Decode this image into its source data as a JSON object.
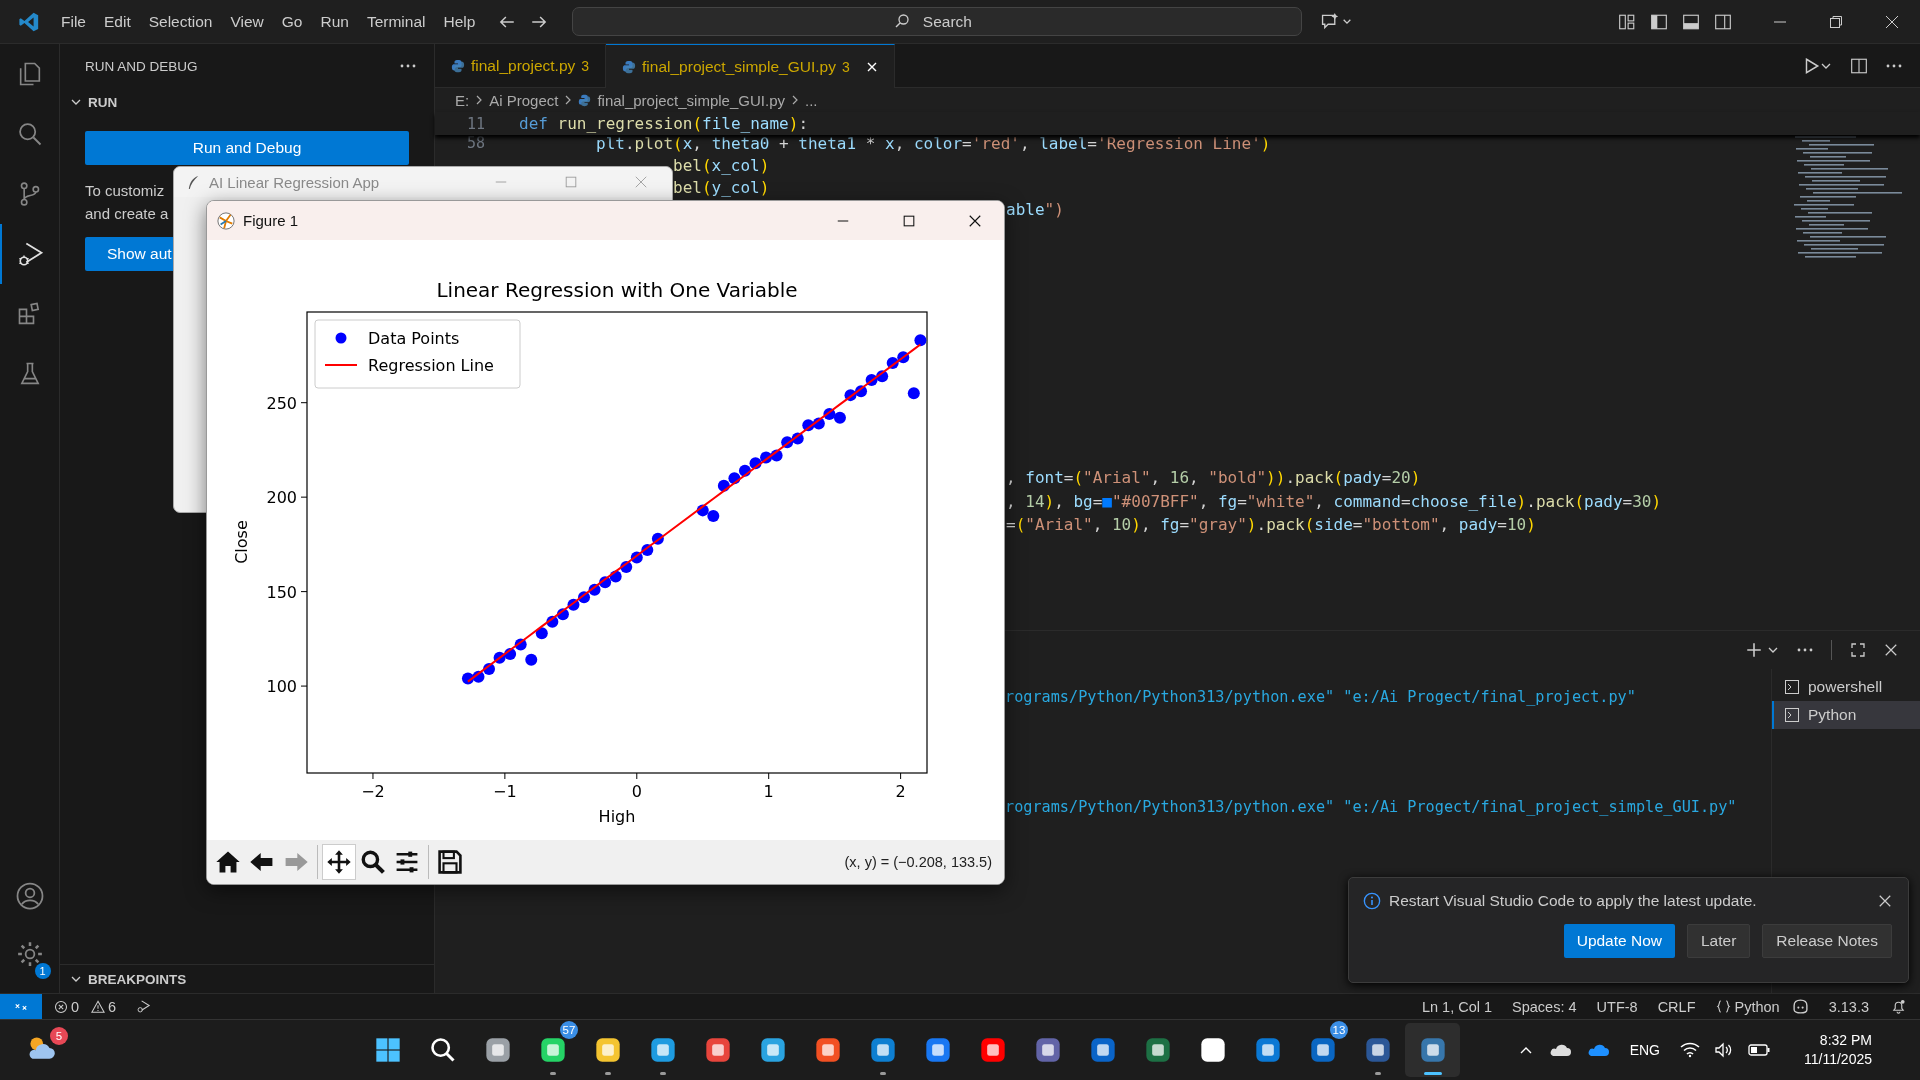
{
  "titlebar": {
    "menu": [
      "File",
      "Edit",
      "Selection",
      "View",
      "Go",
      "Run",
      "Terminal",
      "Help"
    ],
    "search": {
      "placeholder": "Search"
    }
  },
  "activity_bar": {
    "items": [
      {
        "kind": "explorer",
        "selected": false
      },
      {
        "kind": "search",
        "selected": false
      },
      {
        "kind": "source-control",
        "selected": false
      },
      {
        "kind": "run-debug",
        "selected": true
      },
      {
        "kind": "extensions",
        "selected": false
      },
      {
        "kind": "testing",
        "selected": false
      }
    ],
    "settings_badge": "1"
  },
  "sidebar": {
    "title": "RUN AND DEBUG",
    "section": {
      "title": "RUN",
      "expanded": true
    },
    "run_button": "Run and Debug",
    "hint_lines": [
      "To customiz",
      "and create a"
    ],
    "show_button": "Show aut",
    "breakpoints": {
      "title": "BREAKPOINTS",
      "expanded": true
    }
  },
  "editor": {
    "tabs": [
      {
        "name": "final_project.py",
        "problems": "3",
        "selected": false
      },
      {
        "name": "final_project_simple_GUI.py",
        "problems": "3",
        "selected": true
      }
    ],
    "breadcrumb": [
      "E:",
      "Ai Progect",
      "final_project_simple_GUI.py",
      "..."
    ],
    "sticky": {
      "number": "11",
      "code": "def run_regression(file_name):"
    },
    "upper_lines": [
      {
        "number": "58",
        "kind": "indented",
        "code": "plt.plot(x, theta0 + theta1 * x, color='red', label='Regression Line')"
      },
      {
        "kind": "after-tk",
        "code": "bel(x_col)"
      },
      {
        "kind": "after-tk",
        "code": "bel(y_col)"
      },
      {
        "kind": "after-figure",
        "code": "able\")"
      }
    ],
    "lower_lines": [
      {
        "kind": "after-figure",
        "code": ", font=(\"Arial\", 16, \"bold\")).pack(pady=20)"
      },
      {
        "kind": "after-figure",
        "code": ", 14), bg=■\"#007BFF\", fg=\"white\", command=choose_file).pack(pady=30)"
      },
      {
        "kind": "after-figure",
        "code": "=(\"Arial\", 10), fg=\"gray\").pack(side=\"bottom\", pady=10)"
      }
    ]
  },
  "terminal": {
    "lines": [
      "rograms/Python/Python313/python.exe\" \"e:/Ai Progect/final_project.py\"",
      "rograms/Python/Python313/python.exe\" \"e:/Ai Progect/final_project_simple_GUI.py\""
    ],
    "sessions": [
      {
        "name": "powershell",
        "selected": false
      },
      {
        "name": "Python",
        "selected": true
      }
    ]
  },
  "notification": {
    "message": "Restart Visual Studio Code to apply the latest update.",
    "buttons": [
      {
        "label": "Update Now",
        "kind": "primary"
      },
      {
        "label": "Later",
        "kind": "secondary"
      },
      {
        "label": "Release Notes",
        "kind": "secondary"
      }
    ]
  },
  "status_bar": {
    "errors": "0",
    "warnings": "6",
    "items": [
      {
        "kind": "text",
        "text": "Ln 1, Col 1"
      },
      {
        "kind": "text",
        "text": "Spaces: 4"
      },
      {
        "kind": "text",
        "text": "UTF-8"
      },
      {
        "kind": "text",
        "text": "CRLF"
      },
      {
        "kind": "language",
        "text": "Python"
      },
      {
        "kind": "version",
        "text": "3.13.3"
      }
    ]
  },
  "tk_window": {
    "title": "AI Linear Regression App"
  },
  "figure": {
    "title": "Figure 1",
    "coordinates": "(x, y) = (−0.208, 133.5)",
    "toolbar": [
      {
        "kind": "home"
      },
      {
        "kind": "back",
        "disabled": false
      },
      {
        "kind": "forward",
        "disabled": true
      },
      {
        "kind": "pan",
        "selected": true
      },
      {
        "kind": "zoom",
        "selected": false
      },
      {
        "kind": "configure"
      },
      {
        "kind": "save"
      }
    ],
    "chart_data": {
      "type": "scatter",
      "title": "Linear Regression with One Variable",
      "xlabel": "High",
      "ylabel": "Close",
      "x": [
        -1.28,
        -1.2,
        -1.12,
        -1.04,
        -0.96,
        -0.88,
        -0.8,
        -0.72,
        -0.64,
        -0.56,
        -0.48,
        -0.4,
        -0.32,
        -0.24,
        -0.16,
        -0.08,
        0.0,
        0.08,
        0.16,
        0.5,
        0.58,
        0.66,
        0.74,
        0.82,
        0.9,
        0.98,
        1.06,
        1.14,
        1.22,
        1.3,
        1.38,
        1.46,
        1.54,
        1.62,
        1.7,
        1.78,
        1.86,
        1.94,
        2.02,
        2.1,
        2.15
      ],
      "series": [
        {
          "name": "Data Points",
          "type": "scatter",
          "color": "#0000ff",
          "values": [
            104,
            105,
            109,
            115,
            117,
            122,
            114,
            128,
            134,
            138,
            143,
            147,
            151,
            155,
            158,
            163,
            168,
            172,
            178,
            193,
            190,
            206,
            210,
            214,
            218,
            221,
            222,
            229,
            231,
            238,
            239,
            244,
            242,
            254,
            256,
            262,
            264,
            271,
            274,
            255,
            283
          ]
        },
        {
          "name": "Regression Line",
          "type": "line",
          "color": "#ff0000",
          "values": [
            102.4,
            106.6,
            110.8,
            114.9,
            119.1,
            123.2,
            127.4,
            131.6,
            135.7,
            139.9,
            144.0,
            148.2,
            152.4,
            156.5,
            160.7,
            164.8,
            169.0,
            173.2,
            177.3,
            195.0,
            199.2,
            203.3,
            207.5,
            211.6,
            215.8,
            220.0,
            224.1,
            228.3,
            232.4,
            236.6,
            240.8,
            244.9,
            249.1,
            253.2,
            257.4,
            261.6,
            265.7,
            269.9,
            274.0,
            278.2,
            280.8
          ]
        }
      ],
      "legend": "upper left",
      "xlim": [
        -2.5,
        2.2
      ],
      "ylim": [
        54,
        298
      ],
      "xticks": [
        {
          "value": -2,
          "label": "−2"
        },
        {
          "value": -1,
          "label": "−1"
        },
        0,
        1,
        2
      ],
      "yticks": [
        100,
        150,
        200,
        250
      ]
    }
  },
  "taskbar": {
    "widgets_badge": "5",
    "apps": [
      {
        "running": false,
        "active": false
      },
      {
        "running": false,
        "active": false
      },
      {
        "running": false,
        "active": false
      },
      {
        "running": true,
        "active": false,
        "badge": "57"
      },
      {
        "running": true,
        "active": false
      },
      {
        "running": true,
        "active": false
      },
      {
        "running": false,
        "active": false
      },
      {
        "running": false,
        "active": false
      },
      {
        "running": false,
        "active": false
      },
      {
        "running": true,
        "active": false
      },
      {
        "running": false,
        "active": false
      },
      {
        "running": false,
        "active": false
      },
      {
        "running": false,
        "active": false
      },
      {
        "running": false,
        "active": false
      },
      {
        "running": false,
        "active": false
      },
      {
        "running": false,
        "active": false
      },
      {
        "running": false,
        "active": false
      },
      {
        "running": false,
        "active": false,
        "badge": "13"
      },
      {
        "running": true,
        "active": false
      },
      {
        "running": true,
        "active": true
      }
    ],
    "tray": {
      "language": "ENG",
      "time": "8:32 PM",
      "date": "11/11/2025"
    }
  }
}
